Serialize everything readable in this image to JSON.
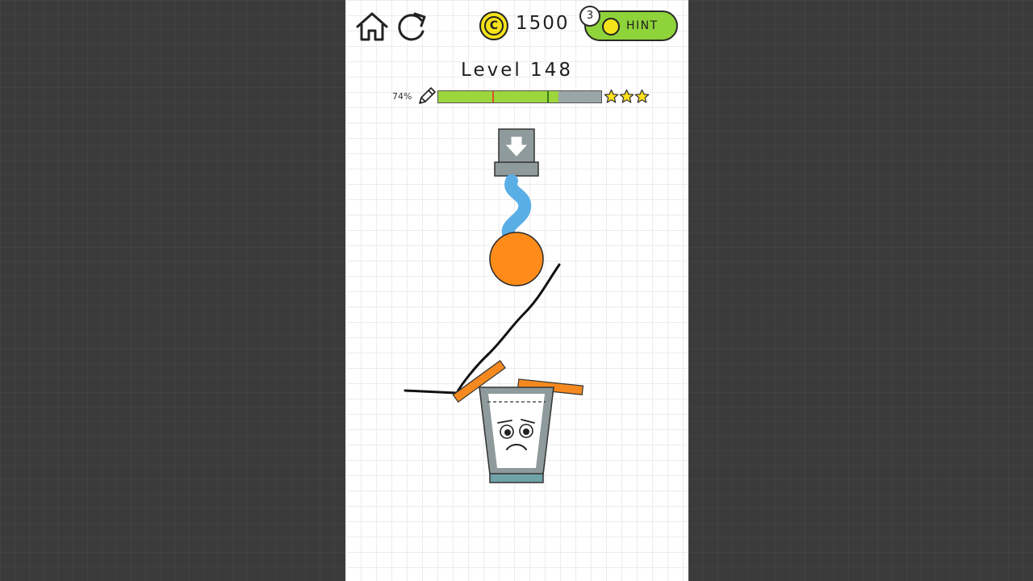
{
  "topbar": {
    "coins": "1500",
    "hint_label": "HINT",
    "hint_count": "3"
  },
  "level": {
    "title": "Level 148"
  },
  "ink": {
    "percent_label": "74%",
    "remaining": 0.74,
    "star_thresholds": [
      0.33,
      0.67
    ],
    "stars_earned": 3
  },
  "icons": {
    "home": "home-icon",
    "restart": "restart-icon",
    "coin": "coin-icon",
    "hint": "lightbulb-icon",
    "pencil": "pencil-icon",
    "star": "star-icon",
    "faucet": "down-arrow-icon"
  },
  "colors": {
    "ball": "#ff8c1a",
    "water": "#5aaee6",
    "plank": "#f5891f",
    "glass": "#8a9496",
    "ink_fill": "#9bd63c",
    "star": "#ffe21a",
    "coin": "#f4e21a",
    "hint_button": "#8fd33a"
  }
}
